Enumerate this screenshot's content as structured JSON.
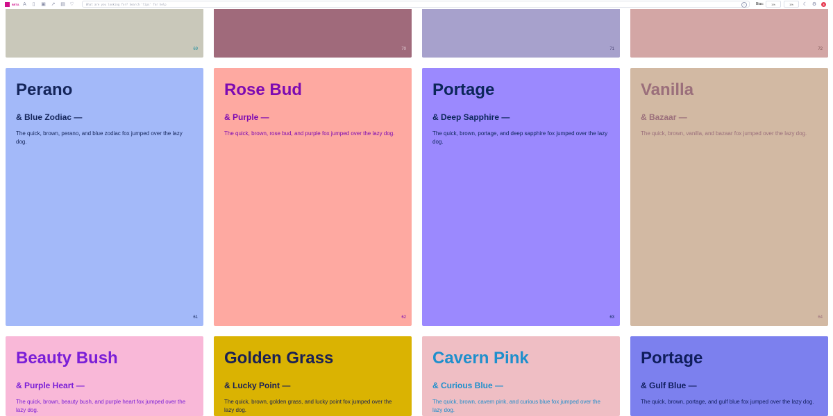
{
  "toolbar": {
    "beta_label": "BETA",
    "search_placeholder": "What are you looking for? Search 'tips' for help",
    "info_symbol": "i",
    "bias_label": "Bias:",
    "bias_values": [
      "1%",
      "1%"
    ],
    "notification_count": "3"
  },
  "cards": [
    {
      "number": "69",
      "bg": "#c9c8ba",
      "num_color": "#1f8fa0"
    },
    {
      "number": "70",
      "bg": "#a06a7b",
      "num_color": "#e2d0d8"
    },
    {
      "number": "71",
      "bg": "#a7a1cc",
      "num_color": "#4a4474"
    },
    {
      "number": "72",
      "bg": "#d3a6a5",
      "num_color": "#7a5050"
    },
    {
      "name": "Perano",
      "pair": "& Blue Zodiac —",
      "sentence": "The quick, brown, perano, and blue zodiac fox jumped over the lazy dog.",
      "number": "61",
      "bg": "#a3b9f9",
      "fg": "#14255a"
    },
    {
      "name": "Rose Bud",
      "pair": "& Purple —",
      "sentence": "The quick, brown, rose bud, and purple fox jumped over the lazy dog.",
      "number": "62",
      "bg": "#fea9a1",
      "fg": "#7d0ab2"
    },
    {
      "name": "Portage",
      "pair": "& Deep Sapphire —",
      "sentence": "The quick, brown, portage, and deep sapphire fox jumped over the lazy dog.",
      "number": "63",
      "bg": "#9b89fe",
      "fg": "#0b2659"
    },
    {
      "name": "Vanilla",
      "pair": "& Bazaar —",
      "sentence": "The quick, brown, vanilla, and bazaar fox jumped over the lazy dog.",
      "number": "64",
      "bg": "#d2b9a3",
      "fg": "#9b6f7b"
    },
    {
      "name": "Beauty Bush",
      "pair": "& Purple Heart —",
      "sentence": "The quick, brown, beauty bush, and purple heart fox jumped over the lazy dog.",
      "bg": "#f9b8d8",
      "fg": "#7a1ed7"
    },
    {
      "name": "Golden Grass",
      "pair": "& Lucky Point —",
      "sentence": "The quick, brown, golden grass, and lucky point fox jumped over the lazy dog.",
      "bg": "#dab302",
      "fg": "#1a2055"
    },
    {
      "name": "Cavern Pink",
      "pair": "& Curious Blue —",
      "sentence": "The quick, brown, cavern pink, and curious blue fox jumped over the lazy dog.",
      "bg": "#efbec4",
      "fg": "#1e8fcc"
    },
    {
      "name": "Portage",
      "pair": "& Gulf Blue —",
      "sentence": "The quick, brown, portage, and gulf blue fox jumped over the lazy dog.",
      "bg": "#7c80ee",
      "fg": "#0f1d5c"
    }
  ]
}
